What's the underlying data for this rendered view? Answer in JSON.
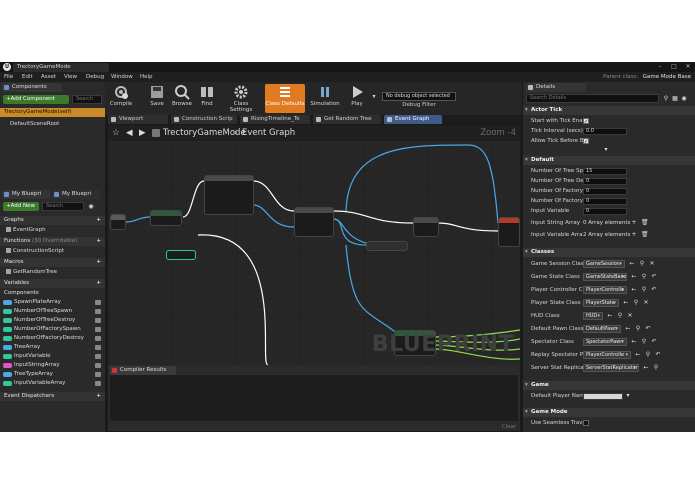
{
  "window": {
    "title": "TrectoryGameMode"
  },
  "menu": [
    "File",
    "Edit",
    "Asset",
    "View",
    "Debug",
    "Window",
    "Help"
  ],
  "parent_class": {
    "label": "Parent class:",
    "value": "Game Mode Base"
  },
  "components_panel": {
    "tab": "Components",
    "add_button": "+Add Component",
    "search_placeholder": "Search",
    "root": "TrectoryGameMode(self)",
    "child": "DefaultSceneRoot"
  },
  "my_blueprint": {
    "tabs": [
      "My Bluepri",
      "My Bluepri"
    ],
    "add_button": "+Add New",
    "search_placeholder": "Search",
    "graphs_label": "Graphs",
    "event_graph": "EventGraph",
    "functions_label": "Functions",
    "functions_count": "(30 Overridable)",
    "construction_script": "ConstructionScript",
    "macros_label": "Macros",
    "macro_item": "GetRandomTree",
    "variables_label": "Variables",
    "components_label": "Components",
    "variables": [
      {
        "name": "SpawnPlateArray",
        "color": "#4aa8e8"
      },
      {
        "name": "NumberOfTreeSpawn",
        "color": "#2fc8a0"
      },
      {
        "name": "NumberOfTreeDestroy",
        "color": "#2fc8a0"
      },
      {
        "name": "NumberOfFactorySpawn",
        "color": "#2fc8a0"
      },
      {
        "name": "NumberOfFactoryDestroy",
        "color": "#2fc8a0"
      },
      {
        "name": "TreeArray",
        "color": "#4aa8e8"
      },
      {
        "name": "InputVariable",
        "color": "#2fc8a0"
      },
      {
        "name": "InputStringArray",
        "color": "#e055c8"
      },
      {
        "name": "TreeTypeArray",
        "color": "#4aa8e8"
      },
      {
        "name": "InputVariableArray",
        "color": "#2fc8a0"
      }
    ],
    "event_dispatchers_label": "Event Dispatchers"
  },
  "toolbar": {
    "compile": "Compile",
    "save": "Save",
    "browse": "Browse",
    "find": "Find",
    "class_settings": "Class Settings",
    "class_defaults": "Class Defaults",
    "simulation": "Simulation",
    "play": "Play",
    "debug_select": "No debug object selected",
    "debug_filter": "Debug Filter"
  },
  "editor_tabs": [
    "Viewport",
    "Construction Scrip",
    "RisingTimeline_Te",
    "Get Random Tree",
    "Event Graph"
  ],
  "graph": {
    "breadcrumb_root": "TrectoryGameMode",
    "breadcrumb_current": "Event Graph",
    "zoom": "Zoom -4",
    "watermark": "BLUEPRINT"
  },
  "compiler": {
    "tab": "Compiler Results",
    "clear": "Clear"
  },
  "details": {
    "tab": "Details",
    "search_placeholder": "Search Details",
    "actor_tick": {
      "title": "Actor Tick",
      "start_with_tick": "Start with Tick Enable",
      "tick_interval_label": "Tick Interval (secs)",
      "tick_interval_value": "0.0",
      "allow_tick": "Allow Tick Before Be"
    },
    "default": {
      "title": "Default",
      "rows": [
        {
          "label": "Number Of Tree Spa",
          "value": "15"
        },
        {
          "label": "Number Of Tree Dest",
          "value": "0"
        },
        {
          "label": "Number Of Factory S",
          "value": "0"
        },
        {
          "label": "Number Of Factory D",
          "value": "0"
        },
        {
          "label": "Input Variable",
          "value": "0"
        }
      ],
      "input_string_array": {
        "label": "Input String Array",
        "value": "0 Array elements"
      },
      "input_variable_array": {
        "label": "Input Variable Array",
        "value": "2 Array elements"
      }
    },
    "classes": {
      "title": "Classes",
      "rows": [
        {
          "label": "Game Session Class",
          "value": "GameSession"
        },
        {
          "label": "Game State Class",
          "value": "GameStateBase"
        },
        {
          "label": "Player Controller Cla",
          "value": "PlayerControlle"
        },
        {
          "label": "Player State Class",
          "value": "PlayerState"
        },
        {
          "label": "HUD Class",
          "value": "HUD"
        },
        {
          "label": "Default Pawn Class",
          "value": "DefaultPawn"
        },
        {
          "label": "Spectator Class",
          "value": "SpectatorPawn"
        },
        {
          "label": "Replay Spectator Pla",
          "value": "PlayerControlle"
        },
        {
          "label": "Server Stat Replicato",
          "value": "ServerStatReplicator"
        }
      ]
    },
    "game": {
      "title": "Game",
      "default_player_name": "Default Player Name"
    },
    "game_mode": {
      "title": "Game Mode",
      "use_seamless": "Use Seamless Trave"
    }
  },
  "colors": {
    "accent_orange": "#e07b22",
    "exec_wire": "#ffffff",
    "array_wire": "#4aa8e8",
    "int_wire": "#2fc8a0",
    "pin_green": "#8ee04e",
    "node_header_red": "#b23a2a"
  }
}
